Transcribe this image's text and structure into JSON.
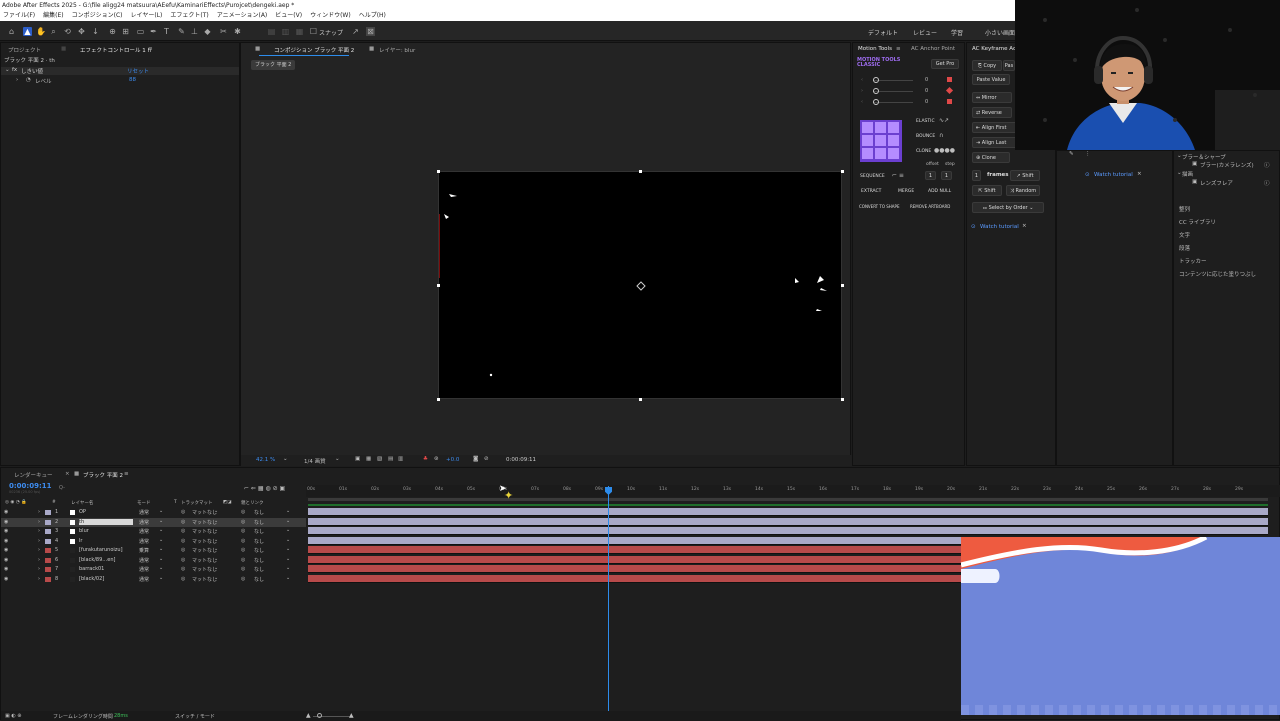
{
  "app": {
    "title": "Adobe After Effects 2025 - G:\\file aligg24 matsuura\\AEefu\\KaminariEffects\\Purojcet\\dengeki.aep *",
    "menu": [
      "ファイル(F)",
      "編集(E)",
      "コンポジション(C)",
      "レイヤー(L)",
      "エフェクト(T)",
      "アニメーション(A)",
      "ビュー(V)",
      "ウィンドウ(W)",
      "ヘルプ(H)"
    ]
  },
  "toolbar": {
    "snap_label": "スナップ",
    "workspaces": [
      "デフォルト",
      "レビュー",
      "学習",
      "小さい画面"
    ]
  },
  "project_panel": {
    "tab_project": "プロジェクト",
    "tab_effects": "エフェクトコントロール 1 h",
    "layer_path": "ブラック 平面 2 · th",
    "effect_name": "しきい値",
    "reset_label": "リセット",
    "param_name": "レベル",
    "param_value": "88"
  },
  "composition": {
    "tab_comp": "コンポジション ブラック 平面 2",
    "tab_layer": "レイヤー: blur",
    "crumb": "ブラック 平面 2",
    "zoom": "42.1 %",
    "resolution": "1/4 画質",
    "exposure": "+0.0",
    "timecode": "0:00:09:11"
  },
  "motion_tools": {
    "title": "Motion Tools",
    "classic_label": "MOTION TOOLS CLASSIC",
    "get_pro": "Get Pro",
    "slider_values": [
      "0",
      "0",
      "0"
    ],
    "elastic": "ELASTIC",
    "bounce": "BOUNCE",
    "clone": "CLONE",
    "offset": "offset",
    "step": "step",
    "sequence": "SEQUENCE",
    "seq_values": [
      "1",
      "1"
    ],
    "extract": "EXTRACT",
    "merge": "MERGE",
    "add_null": "ADD NULL",
    "convert_to_shape": "CONVERT TO SHAPE",
    "remove_artboard": "REMOVE ARTBOARD"
  },
  "anchor_panel": {
    "title": "AC Anchor Point",
    "tutorial": "Watch tutorial"
  },
  "keyframe_panel": {
    "title": "AC Keyframe Act",
    "copy": "Copy",
    "paste": "Pas",
    "paste_value": "Paste Value",
    "mirror": "Mirror",
    "reverse": "Reverse",
    "align_first": "Align First",
    "align_last": "Align Last",
    "clone": "Clone",
    "frames_num": "1",
    "frames": "frames",
    "shift": "Shift",
    "shift2": "Shift",
    "random": "Random",
    "select_by_order": "Select by Order",
    "tutorial": "Watch tutorial",
    "tutorial2": "Watch tutorial"
  },
  "right_panel": {
    "items_top": [
      "ブラー＆シャープ",
      "ブラー(カメラレンズ)",
      "描画",
      "レンズフレア"
    ],
    "items": [
      "整列",
      "CC ライブラリ",
      "文字",
      "段落",
      "トラッカー",
      "コンテンツに応じた塗りつぶし"
    ]
  },
  "timeline": {
    "tab_render": "レンダーキュー",
    "tab_comp": "ブラック 平面 2",
    "timecode": "0:00:09:11",
    "timecode_sub": "00236 (25.00 fps)",
    "search_placeholder": "Q-",
    "col_num": "#",
    "col_name": "レイヤー名",
    "col_mode": "モード",
    "col_t": "T",
    "col_track": "トラックマット",
    "col_parent": "親とリンク",
    "layers": [
      {
        "num": "1",
        "name": "OP",
        "mode": "通常",
        "track": "マットなし",
        "parent": "なし",
        "color": "#a9a9c8"
      },
      {
        "num": "2",
        "name": "th",
        "mode": "通常",
        "track": "マットなし",
        "parent": "なし",
        "color": "#a9a9c8"
      },
      {
        "num": "3",
        "name": "blur",
        "mode": "通常",
        "track": "マットなし",
        "parent": "なし",
        "color": "#a9a9c8"
      },
      {
        "num": "4",
        "name": "lr",
        "mode": "通常",
        "track": "マットなし",
        "parent": "なし",
        "color": "#a9a9c8"
      },
      {
        "num": "5",
        "name": "[furakutarunoizu]",
        "mode": "乗算",
        "track": "マットなし",
        "parent": "なし",
        "color": "#b84a4a"
      },
      {
        "num": "6",
        "name": "[black/89…en]",
        "mode": "通常",
        "track": "マットなし",
        "parent": "なし",
        "color": "#b84a4a"
      },
      {
        "num": "7",
        "name": "barrack01",
        "mode": "通常",
        "track": "マットなし",
        "parent": "なし",
        "color": "#b84a4a"
      },
      {
        "num": "8",
        "name": "[black/02]",
        "mode": "通常",
        "track": "マットなし",
        "parent": "なし",
        "color": "#b84a4a"
      }
    ],
    "ruler": [
      "00s",
      "01s",
      "02s",
      "03s",
      "04s",
      "05s",
      "06s",
      "07s",
      "08s",
      "09s",
      "10s",
      "11s",
      "12s",
      "13s",
      "14s",
      "15s",
      "16s",
      "17s",
      "18s",
      "19s",
      "20s",
      "21s",
      "22s",
      "23s",
      "24s",
      "25s",
      "26s",
      "27s",
      "28s",
      "29s"
    ],
    "status_render": "フレームレンダリング時間",
    "status_ms": "28ms",
    "status_switch": "スイッチ / モード"
  },
  "colors": {
    "accent": "#2d8ceb",
    "mt_purple": "#8a55e6",
    "layer_lav": "#a9a9c8",
    "layer_red": "#b84a4a",
    "overlay_blue": "#6f86d9",
    "overlay_red": "#e85a3e"
  }
}
